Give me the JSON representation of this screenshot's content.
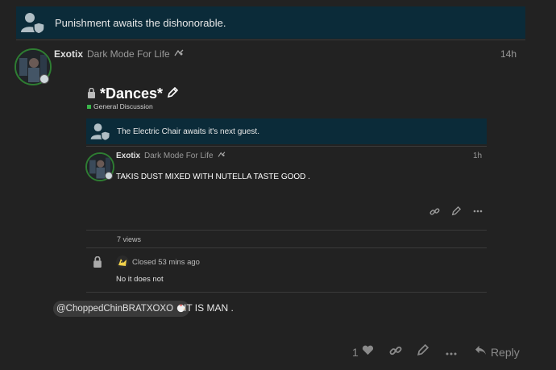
{
  "top_banner": {
    "text": "Punishment awaits the dishonorable."
  },
  "post": {
    "username": "Exotix",
    "user_title": "Dark Mode For Life",
    "time": "14h",
    "mention": "@ChoppedChinBRATXOXO",
    "text": "IT IS MAN ."
  },
  "onebox": {
    "title": "*Dances*",
    "category": "General Discussion",
    "category_color": "#3ab54a",
    "banner_text": "The Electric Chair awaits it's next guest.",
    "inner_post": {
      "username": "Exotix",
      "user_title": "Dark Mode For Life",
      "time": "1h",
      "text": "TAKIS DUST MIXED WITH NUTELLA TASTE GOOD ."
    },
    "views": "7 views",
    "closed": {
      "status": "Closed 53 mins ago",
      "reply": "No it does not"
    }
  },
  "footer": {
    "like_count": "1",
    "reply_label": "Reply"
  },
  "colors": {
    "background": "#222222",
    "banner": "#0b2b39",
    "avatar_ring": "#2e7d32"
  }
}
